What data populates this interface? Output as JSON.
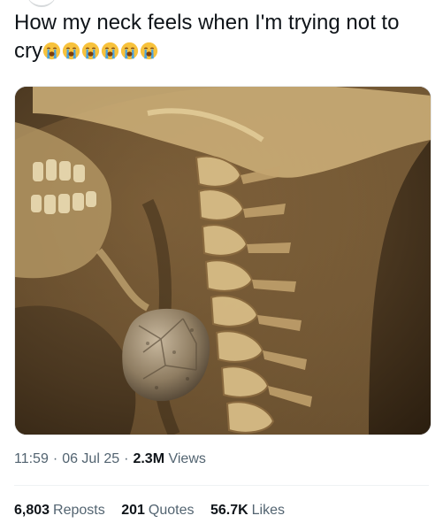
{
  "tweet": {
    "text": "How my neck feels when I'm trying not to cry",
    "emoji": [
      "loudly-crying-face-emoji",
      "loudly-crying-face-emoji",
      "loudly-crying-face-emoji",
      "loudly-crying-face-emoji",
      "loudly-crying-face-emoji",
      "loudly-crying-face-emoji"
    ],
    "emoji_colors": {
      "face": "#f7c23c",
      "tears": "#4aa3df",
      "mouth": "#7a3f0e"
    }
  },
  "media": {
    "description_icon": "xray-neck-with-rock-image",
    "tones": {
      "dark": "#3b2a17",
      "mid": "#8a6a3f",
      "bone": "#cfb27a",
      "rock": "#9b8a72"
    }
  },
  "meta": {
    "time": "11:59",
    "date": "06 Jul 25",
    "views_count": "2.3M",
    "views_label": "Views"
  },
  "stats": {
    "reposts_count": "6,803",
    "reposts_label": "Reposts",
    "quotes_count": "201",
    "quotes_label": "Quotes",
    "likes_count": "56.7K",
    "likes_label": "Likes"
  }
}
